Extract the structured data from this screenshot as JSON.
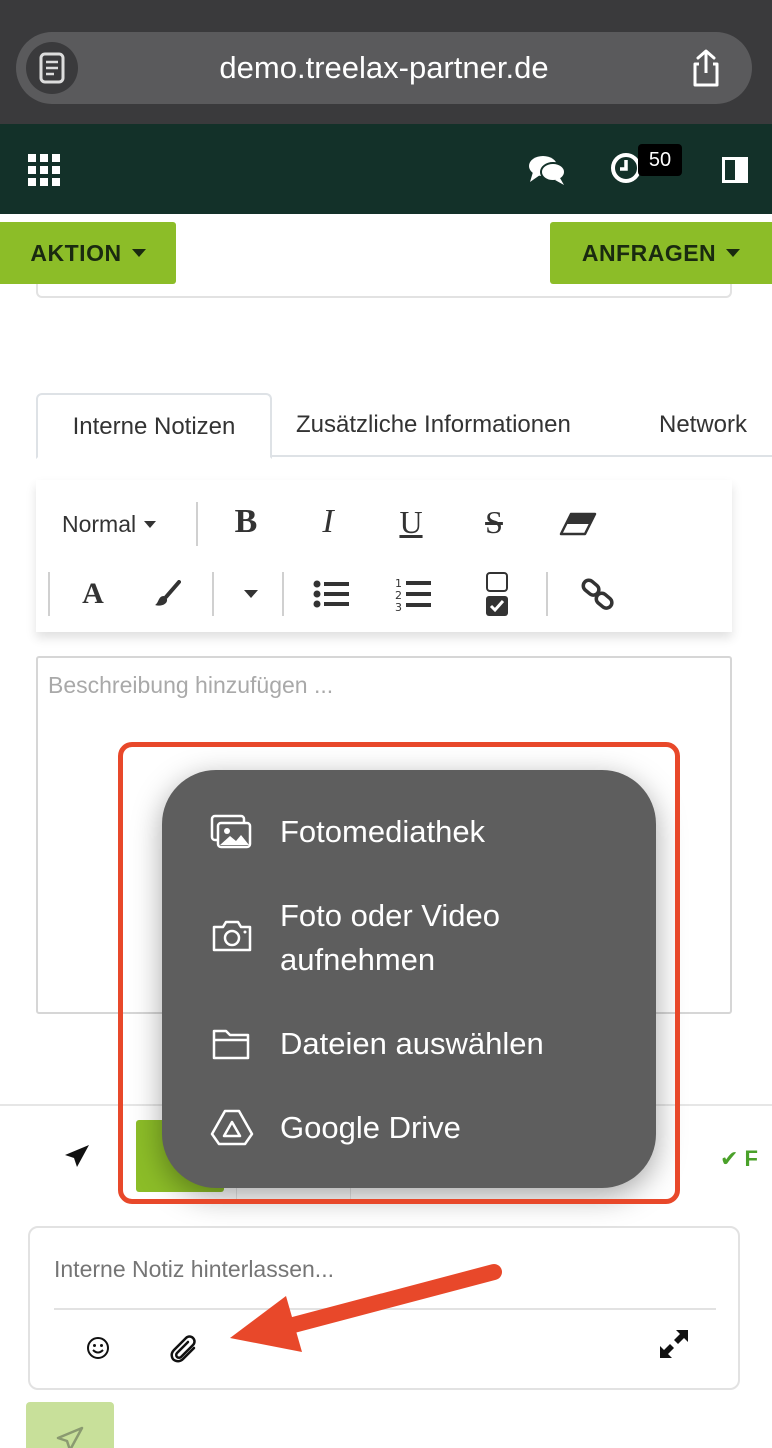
{
  "browser": {
    "url": "demo.treelax-partner.de"
  },
  "header": {
    "notification_count": "50"
  },
  "actions": {
    "aktion_label": "AKTION",
    "anfragen_label": "ANFRAGEN"
  },
  "tabs": [
    {
      "label": "Interne Notizen",
      "active": true
    },
    {
      "label": "Zusätzliche Informationen",
      "active": false
    },
    {
      "label": "Network",
      "active": false
    }
  ],
  "toolbar": {
    "heading_select": "Normal",
    "bold": "B",
    "italic": "I",
    "underline": "U",
    "strike": "S",
    "text_color": "A",
    "icons": [
      "eraser-icon",
      "paintbrush-icon",
      "bullet-list-icon",
      "numbered-list-icon",
      "checklist-icon",
      "link-icon"
    ]
  },
  "description": {
    "placeholder": "Beschreibung hinzufügen ..."
  },
  "popup_menu": {
    "items": [
      {
        "label": "Fotomediathek",
        "icon": "photo-library-icon"
      },
      {
        "label": "Foto oder Video\naufnehmen",
        "icon": "camera-icon"
      },
      {
        "label": "Dateien auswählen",
        "icon": "folder-icon"
      },
      {
        "label": "Google Drive",
        "icon": "google-drive-icon"
      }
    ]
  },
  "bottom_strip": {
    "check_label": "✔ F"
  },
  "note": {
    "placeholder": "Interne Notiz hinterlassen..."
  },
  "colors": {
    "header_bg": "#133129",
    "accent_green": "#8cbd28",
    "annotation_red": "#e8482a",
    "menu_bg": "#5e5e5e"
  }
}
